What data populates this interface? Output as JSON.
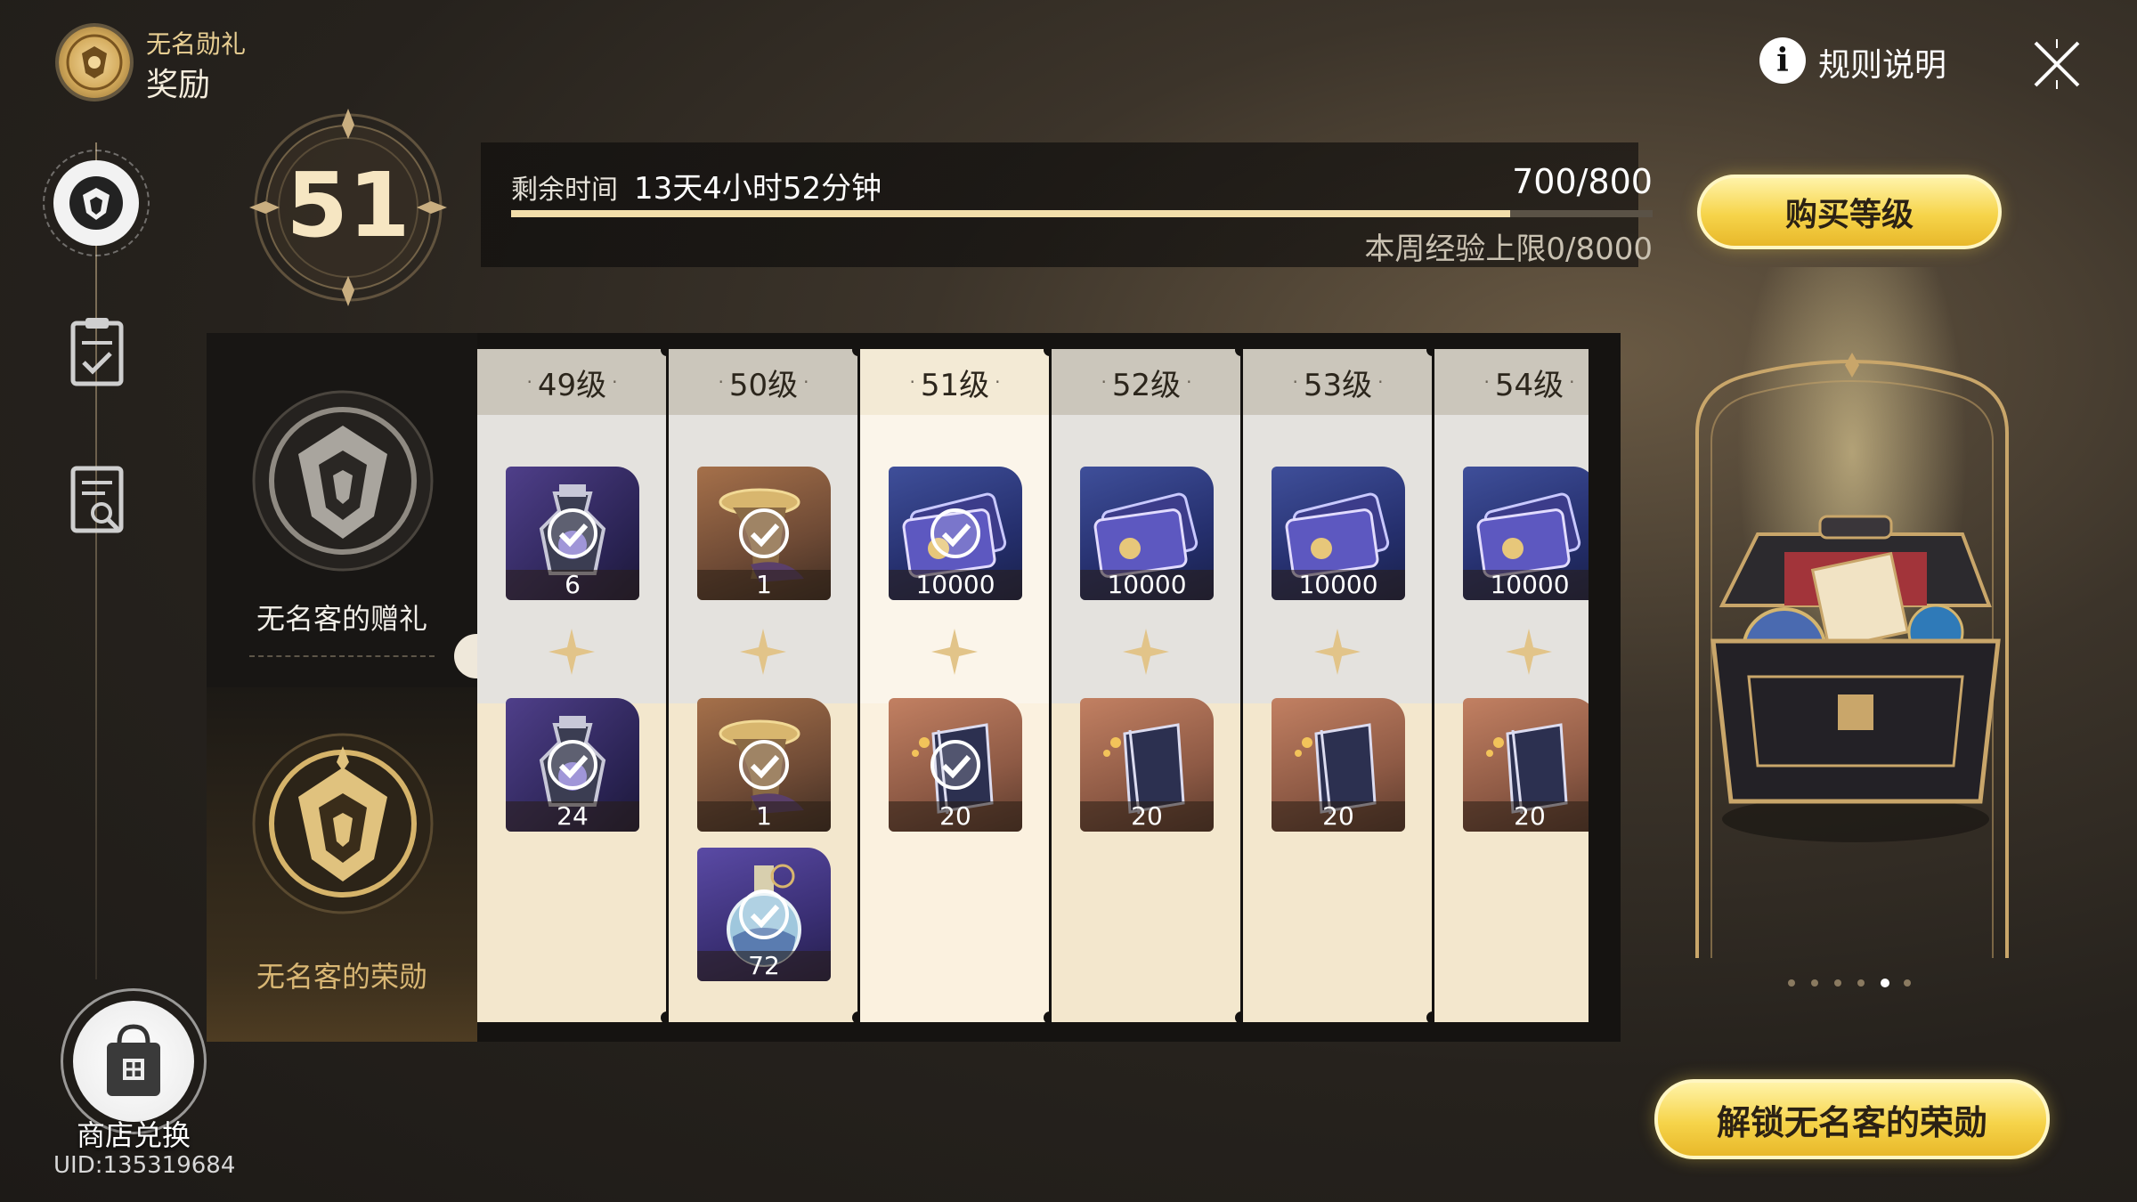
{
  "header": {
    "pass_name": "无名勋礼",
    "section": "奖励"
  },
  "level": {
    "current": "51",
    "remaining_label": "剩余时间",
    "remaining_value": "13天4小时52分钟",
    "xp_text": "700/800",
    "xp_progress": 0.875,
    "weekly_cap": "本周经验上限0/8000"
  },
  "buttons": {
    "buy_level": "购买等级",
    "rules": "规则说明",
    "unlock": "解锁无名客的荣勋"
  },
  "tiers": {
    "free": "无名客的赠礼",
    "paid": "无名客的荣勋"
  },
  "columns": [
    {
      "label": "49级",
      "current": false,
      "free": [
        {
          "qty": "6",
          "icon": "potion-bottle-icon",
          "bg": "bg-purple",
          "claimed": true
        }
      ],
      "paid": [
        {
          "qty": "24",
          "icon": "potion-bottle-icon",
          "bg": "bg-purple",
          "claimed": true
        }
      ]
    },
    {
      "label": "50级",
      "current": false,
      "free": [
        {
          "qty": "1",
          "icon": "horn-item-icon",
          "bg": "bg-brown",
          "claimed": true
        }
      ],
      "paid": [
        {
          "qty": "1",
          "icon": "horn-item-icon",
          "bg": "bg-brown",
          "claimed": true
        },
        {
          "qty": "72",
          "icon": "flask-icon",
          "bg": "bg-violet",
          "claimed": true
        }
      ]
    },
    {
      "label": "51级",
      "current": true,
      "free": [
        {
          "qty": "10000",
          "icon": "credit-card-icon",
          "bg": "bg-navy",
          "claimed": true
        }
      ],
      "paid": [
        {
          "qty": "20",
          "icon": "book-icon",
          "bg": "bg-rust",
          "claimed": true
        }
      ]
    },
    {
      "label": "52级",
      "current": false,
      "free": [
        {
          "qty": "10000",
          "icon": "credit-card-icon",
          "bg": "bg-navy",
          "claimed": false
        }
      ],
      "paid": [
        {
          "qty": "20",
          "icon": "book-icon",
          "bg": "bg-rust",
          "claimed": false
        }
      ]
    },
    {
      "label": "53级",
      "current": false,
      "free": [
        {
          "qty": "10000",
          "icon": "credit-card-icon",
          "bg": "bg-navy",
          "claimed": false
        }
      ],
      "paid": [
        {
          "qty": "20",
          "icon": "book-icon",
          "bg": "bg-rust",
          "claimed": false
        }
      ]
    },
    {
      "label": "54级",
      "current": false,
      "free": [
        {
          "qty": "10000",
          "icon": "credit-card-icon",
          "bg": "bg-navy",
          "claimed": false
        }
      ],
      "paid": [
        {
          "qty": "20",
          "icon": "book-icon",
          "bg": "bg-rust",
          "claimed": false
        }
      ]
    }
  ],
  "shop": {
    "label": "商店兑换",
    "uid": "UID:135319684"
  },
  "preview": {
    "page_count": 6,
    "active_page": 5
  },
  "colors": {
    "gold": "#f6d44a",
    "accent_text": "#d9b774"
  }
}
